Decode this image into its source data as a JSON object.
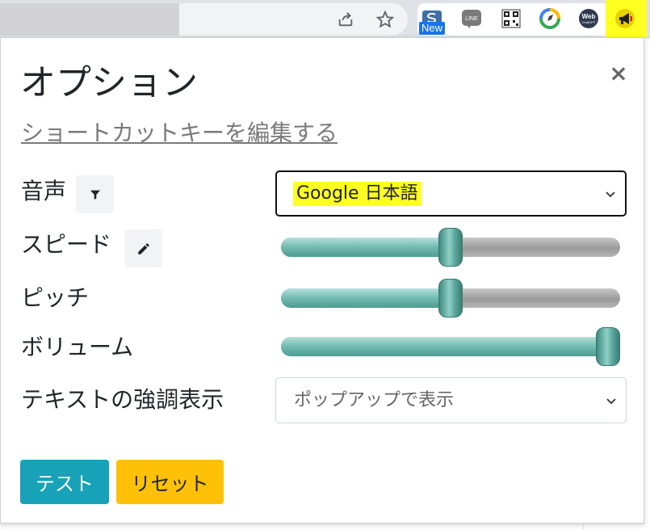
{
  "browser": {
    "extensions": [
      {
        "icon": "s-new-extension-icon",
        "badge": "New"
      },
      {
        "icon": "line-extension-icon",
        "label": "LINE"
      },
      {
        "icon": "qr-code-extension-icon"
      },
      {
        "icon": "compass-extension-icon"
      },
      {
        "icon": "web-chatgpt-extension-icon",
        "label": "Web",
        "sublabel": "ChatGPT"
      },
      {
        "icon": "megaphone-extension-icon",
        "highlight": "#ffff22"
      }
    ]
  },
  "popup": {
    "title": "オプション",
    "close": "×",
    "shortcut_link": "ショートカットキーを編集する",
    "voice": {
      "label": "音声",
      "icon": "filter-icon",
      "selected": "Google 日本語"
    },
    "speed": {
      "label": "スピード",
      "icon": "pencil-icon",
      "value": 0.5
    },
    "pitch": {
      "label": "ピッチ",
      "value": 0.5
    },
    "volume": {
      "label": "ボリューム",
      "value": 1.0
    },
    "highlight": {
      "label": "テキストの強調表示",
      "selected": "ポップアップで表示"
    },
    "buttons": {
      "test": "テスト",
      "reset": "リセット"
    }
  },
  "colors": {
    "test_button": "#17a2b8",
    "reset_button": "#ffc107",
    "slider_fill": "#72bab0",
    "text_highlight": "#ffff22"
  }
}
